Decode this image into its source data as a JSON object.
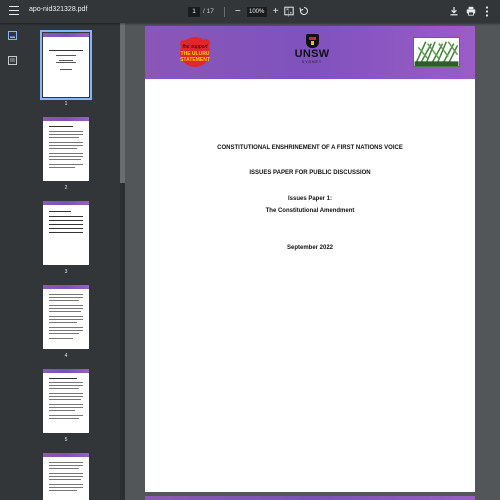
{
  "toolbar": {
    "filename": "apo-nid321328.pdf",
    "current_page": "1",
    "page_total": "/ 17",
    "zoom": "100%",
    "zoom_out_symbol": "−",
    "zoom_in_symbol": "+",
    "icons": [
      "menu-icon",
      "fit-page-icon",
      "rotate-icon",
      "download-icon",
      "print-icon",
      "more-icon"
    ]
  },
  "sidebar": {
    "tools": [
      "thumbnails-icon",
      "outline-icon"
    ],
    "thumbnails": [
      {
        "label": "1",
        "selected": true
      },
      {
        "label": "2",
        "selected": false
      },
      {
        "label": "3",
        "selected": false
      },
      {
        "label": "4",
        "selected": false
      },
      {
        "label": "5",
        "selected": false
      },
      {
        "label": "6",
        "selected": false
      }
    ]
  },
  "document": {
    "banner_colors": {
      "start": "#8a57b7",
      "end": "#9b5cc6"
    },
    "logo_left_text": [
      "the support",
      "THE ULURU",
      "STATEMENT"
    ],
    "logo_center_text": "UNSW",
    "logo_center_sub": "SYDNEY",
    "title": "CONSTITUTIONAL ENSHRINEMENT OF A FIRST NATIONS VOICE",
    "subtitle": "ISSUES PAPER FOR PUBLIC DISCUSSION",
    "paper_number": "Issues Paper 1:",
    "paper_topic": "The Constitutional Amendment",
    "date": "September 2022"
  }
}
